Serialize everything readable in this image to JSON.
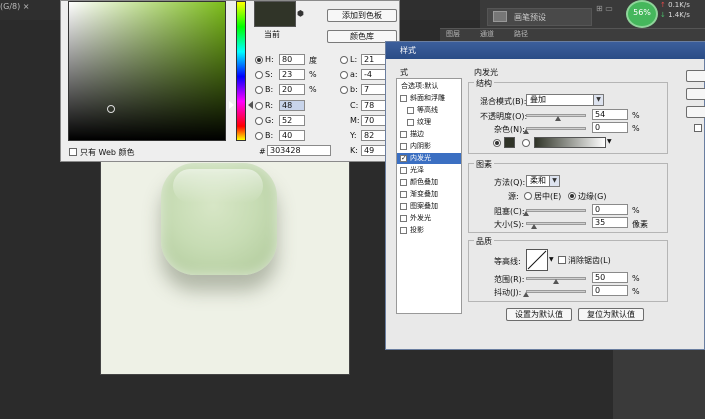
{
  "document": {
    "tab_fragment": "(G/8) ×"
  },
  "topbar": {
    "preset_button": "画笔预设",
    "badge": "56%",
    "net_up": "0.1K/s",
    "net_down": "1.4K/s",
    "panel_tabs": [
      "图层",
      "通道",
      "路径"
    ]
  },
  "color_picker": {
    "current_label": "当前",
    "add_to_swatches": "添加到色板",
    "color_libraries": "颜色库",
    "hsb": [
      {
        "key": "H:",
        "value": "80",
        "unit": "度"
      },
      {
        "key": "S:",
        "value": "23",
        "unit": "%"
      },
      {
        "key": "B:",
        "value": "20",
        "unit": "%"
      }
    ],
    "rgb": [
      {
        "key": "R:",
        "value": "48"
      },
      {
        "key": "G:",
        "value": "52"
      },
      {
        "key": "B:",
        "value": "40"
      }
    ],
    "lab": [
      {
        "key": "L:",
        "value": "21"
      },
      {
        "key": "a:",
        "value": "-4"
      },
      {
        "key": "b:",
        "value": "7"
      }
    ],
    "cmyk": [
      {
        "key": "C:",
        "value": "78",
        "unit": "%"
      },
      {
        "key": "M:",
        "value": "70",
        "unit": "%"
      },
      {
        "key": "Y:",
        "value": "82",
        "unit": "%"
      },
      {
        "key": "K:",
        "value": "49",
        "unit": "%"
      }
    ],
    "hex_label": "#",
    "hex_value": "303428",
    "web_only": "只有 Web 颜色",
    "new_color": "#303428"
  },
  "layer_style": {
    "title": "样式",
    "list_header": "式",
    "list_items": [
      {
        "label": "合选项:默认",
        "checkbox": false,
        "checked": false
      },
      {
        "label": "斜面和浮雕",
        "checkbox": true,
        "checked": false
      },
      {
        "label": "等高线",
        "checkbox": true,
        "checked": false
      },
      {
        "label": "纹理",
        "checkbox": true,
        "checked": false
      },
      {
        "label": "描边",
        "checkbox": true,
        "checked": false
      },
      {
        "label": "内阴影",
        "checkbox": true,
        "checked": false
      },
      {
        "label": "内发光",
        "checkbox": true,
        "checked": true
      },
      {
        "label": "光泽",
        "checkbox": true,
        "checked": false
      },
      {
        "label": "颜色叠加",
        "checkbox": true,
        "checked": false
      },
      {
        "label": "渐变叠加",
        "checkbox": true,
        "checked": false
      },
      {
        "label": "图案叠加",
        "checkbox": true,
        "checked": false
      },
      {
        "label": "外发光",
        "checkbox": true,
        "checked": false
      },
      {
        "label": "投影",
        "checkbox": true,
        "checked": false
      }
    ],
    "section_title": "内发光",
    "structure": {
      "label": "结构",
      "blend_mode_label": "混合模式(B):",
      "blend_mode_value": "叠加",
      "opacity_label": "不透明度(O):",
      "opacity_value": "54",
      "opacity_unit": "%",
      "opacity_level": 0.54,
      "noise_label": "杂色(N):",
      "noise_value": "0",
      "noise_unit": "%",
      "noise_level": 0.0
    },
    "elements": {
      "label": "图素",
      "method_label": "方法(Q):",
      "method_value": "柔和",
      "source_label": "源:",
      "source_center": "居中(E)",
      "source_edge": "边缘(G)",
      "choke_label": "阻塞(C):",
      "choke_value": "0",
      "choke_unit": "%",
      "choke_level": 0.0,
      "size_label": "大小(S):",
      "size_value": "35",
      "size_unit": "像素",
      "size_level": 0.14
    },
    "quality": {
      "label": "品质",
      "contour_label": "等高线:",
      "anti_alias_label": "消除锯齿(L)",
      "range_label": "范围(R):",
      "range_value": "50",
      "range_unit": "%",
      "range_level": 0.5,
      "jitter_label": "抖动(J):",
      "jitter_value": "0",
      "jitter_unit": "%",
      "jitter_level": 0.0
    },
    "make_default": "设置为默认值",
    "reset_default": "复位为默认值"
  }
}
